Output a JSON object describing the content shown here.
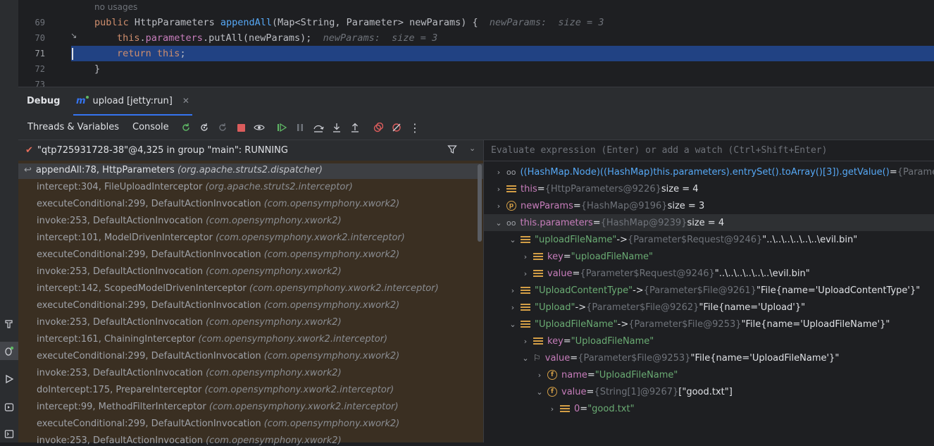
{
  "editor": {
    "usage_hint": "no usages",
    "lines": [
      {
        "num": "69"
      },
      {
        "num": "70"
      },
      {
        "num": "71"
      },
      {
        "num": "72"
      },
      {
        "num": "73"
      }
    ],
    "l69": {
      "kw": "public",
      "type": "HttpParameters",
      "method": "appendAll",
      "sig": "(Map<String, Parameter> newParams) {",
      "hint": "newParams:  size = 3"
    },
    "l70": {
      "kw": "this",
      "dot": ".",
      "field": "parameters",
      "rest": ".putAll(newParams);",
      "hint": "newParams:  size = 3"
    },
    "l71": {
      "kw": "return",
      "sp": " ",
      "kw2": "this",
      "rest": ";"
    },
    "l72": {
      "text": "}"
    }
  },
  "debug": {
    "title": "Debug",
    "run_config": "upload [jetty:run]",
    "tabs": [
      "Threads & Variables",
      "Console"
    ]
  },
  "thread": {
    "label": "\"qtp725931728-38\"@4,325 in group \"main\": RUNNING"
  },
  "frames": [
    {
      "method": "appendAll:78, HttpParameters",
      "pkg": "(org.apache.struts2.dispatcher)"
    },
    {
      "method": "intercept:304, FileUploadInterceptor",
      "pkg": "(org.apache.struts2.interceptor)"
    },
    {
      "method": "executeConditional:299, DefaultActionInvocation",
      "pkg": "(com.opensymphony.xwork2)"
    },
    {
      "method": "invoke:253, DefaultActionInvocation",
      "pkg": "(com.opensymphony.xwork2)"
    },
    {
      "method": "intercept:101, ModelDrivenInterceptor",
      "pkg": "(com.opensymphony.xwork2.interceptor)"
    },
    {
      "method": "executeConditional:299, DefaultActionInvocation",
      "pkg": "(com.opensymphony.xwork2)"
    },
    {
      "method": "invoke:253, DefaultActionInvocation",
      "pkg": "(com.opensymphony.xwork2)"
    },
    {
      "method": "intercept:142, ScopedModelDrivenInterceptor",
      "pkg": "(com.opensymphony.xwork2.interceptor)"
    },
    {
      "method": "executeConditional:299, DefaultActionInvocation",
      "pkg": "(com.opensymphony.xwork2)"
    },
    {
      "method": "invoke:253, DefaultActionInvocation",
      "pkg": "(com.opensymphony.xwork2)"
    },
    {
      "method": "intercept:161, ChainingInterceptor",
      "pkg": "(com.opensymphony.xwork2.interceptor)"
    },
    {
      "method": "executeConditional:299, DefaultActionInvocation",
      "pkg": "(com.opensymphony.xwork2)"
    },
    {
      "method": "invoke:253, DefaultActionInvocation",
      "pkg": "(com.opensymphony.xwork2)"
    },
    {
      "method": "doIntercept:175, PrepareInterceptor",
      "pkg": "(com.opensymphony.xwork2.interceptor)"
    },
    {
      "method": "intercept:99, MethodFilterInterceptor",
      "pkg": "(com.opensymphony.xwork2.interceptor)"
    },
    {
      "method": "executeConditional:299, DefaultActionInvocation",
      "pkg": "(com.opensymphony.xwork2)"
    },
    {
      "method": "invoke:253, DefaultActionInvocation",
      "pkg": "(com.opensymphony.xwork2)"
    }
  ],
  "eval": {
    "placeholder": "Evaluate expression (Enter) or add a watch (Ctrl+Shift+Enter)"
  },
  "variables": {
    "watch": {
      "name": "((HashMap.Node)((HashMap)this.parameters).entrySet().toArray()[3]).getValue()",
      "eq": " = ",
      "type": "{Paramete"
    },
    "this": {
      "name": "this",
      "eq": " = ",
      "type": "{HttpParameters@9226}",
      "val": "  size = 4"
    },
    "newParams": {
      "name": "newParams",
      "eq": " = ",
      "type": "{HashMap@9196}",
      "val": "  size = 3"
    },
    "parameters": {
      "name": "this.parameters",
      "eq": " = ",
      "type": "{HashMap@9239}",
      "val": "  size = 4"
    },
    "e1": {
      "name": "\"uploadFileName\"",
      "arrow": " -> ",
      "type": "{Parameter$Request@9246}",
      "val": " \"..\\..\\..\\..\\..\\..\\evil.bin\""
    },
    "e1key": {
      "name": "key",
      "eq": " = ",
      "val": "\"uploadFileName\""
    },
    "e1val": {
      "name": "value",
      "eq": " = ",
      "type": "{Parameter$Request@9246}",
      "val": " \"..\\..\\..\\..\\..\\..\\evil.bin\""
    },
    "e2": {
      "name": "\"UploadContentType\"",
      "arrow": " -> ",
      "type": "{Parameter$File@9261}",
      "val": " \"File{name='UploadContentType'}\""
    },
    "e3": {
      "name": "\"Upload\"",
      "arrow": " -> ",
      "type": "{Parameter$File@9262}",
      "val": " \"File{name='Upload'}\""
    },
    "e4": {
      "name": "\"UploadFileName\"",
      "arrow": " -> ",
      "type": "{Parameter$File@9253}",
      "val": " \"File{name='UploadFileName'}\""
    },
    "e4key": {
      "name": "key",
      "eq": " = ",
      "val": "\"UploadFileName\""
    },
    "e4val": {
      "name": "value",
      "eq": " = ",
      "type": "{Parameter$File@9253}",
      "val": " \"File{name='UploadFileName'}\""
    },
    "e4name": {
      "name": "name",
      "eq": " = ",
      "val": "\"UploadFileName\""
    },
    "e4value": {
      "name": "value",
      "eq": " = ",
      "type": "{String[1]@9267}",
      "val": " [\"good.txt\"]"
    },
    "e4zero": {
      "name": "0",
      "eq": " = ",
      "val": "\"good.txt\""
    }
  }
}
